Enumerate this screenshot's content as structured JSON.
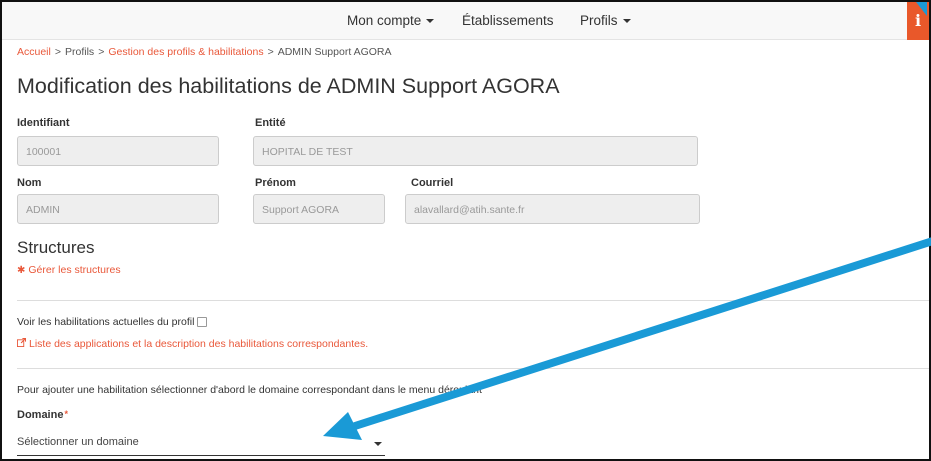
{
  "navbar": {
    "items": [
      {
        "label": "Mon compte",
        "has_caret": true
      },
      {
        "label": "Établissements",
        "has_caret": false
      },
      {
        "label": "Profils",
        "has_caret": true
      }
    ],
    "info_label": "i"
  },
  "breadcrumb": {
    "items": [
      "Accueil",
      "Profils",
      "Gestion des profils & habilitations",
      "ADMIN Support AGORA"
    ],
    "separator": ">"
  },
  "page_title": "Modification des habilitations de ADMIN Support AGORA",
  "form": {
    "identifiant_label": "Identifiant",
    "identifiant_value": "100001",
    "entite_label": "Entité",
    "entite_value": "HOPITAL DE TEST",
    "nom_label": "Nom",
    "nom_value": "ADMIN",
    "prenom_label": "Prénom",
    "prenom_value": "Support AGORA",
    "courriel_label": "Courriel",
    "courriel_value": "alavallard@atih.sante.fr"
  },
  "structures": {
    "title": "Structures",
    "manage_link": "Gérer les structures"
  },
  "habilitations": {
    "checkbox_label": "Voir les habilitations actuelles du profil",
    "checkbox_checked": false,
    "apps_link": "Liste des applications et la description des habilitations correspondantes."
  },
  "domain": {
    "hint": "Pour ajouter une habilitation sélectionner d'abord le domaine correspondant dans le menu déroulant",
    "label": "Domaine",
    "required_mark": "*",
    "placeholder": "Sélectionner un domaine"
  },
  "colors": {
    "accent": "#e9583a",
    "annotation_arrow": "#1a9ad6"
  },
  "icons": [
    "caret-down-icon",
    "info-icon",
    "gear-icon",
    "external-link-icon"
  ]
}
